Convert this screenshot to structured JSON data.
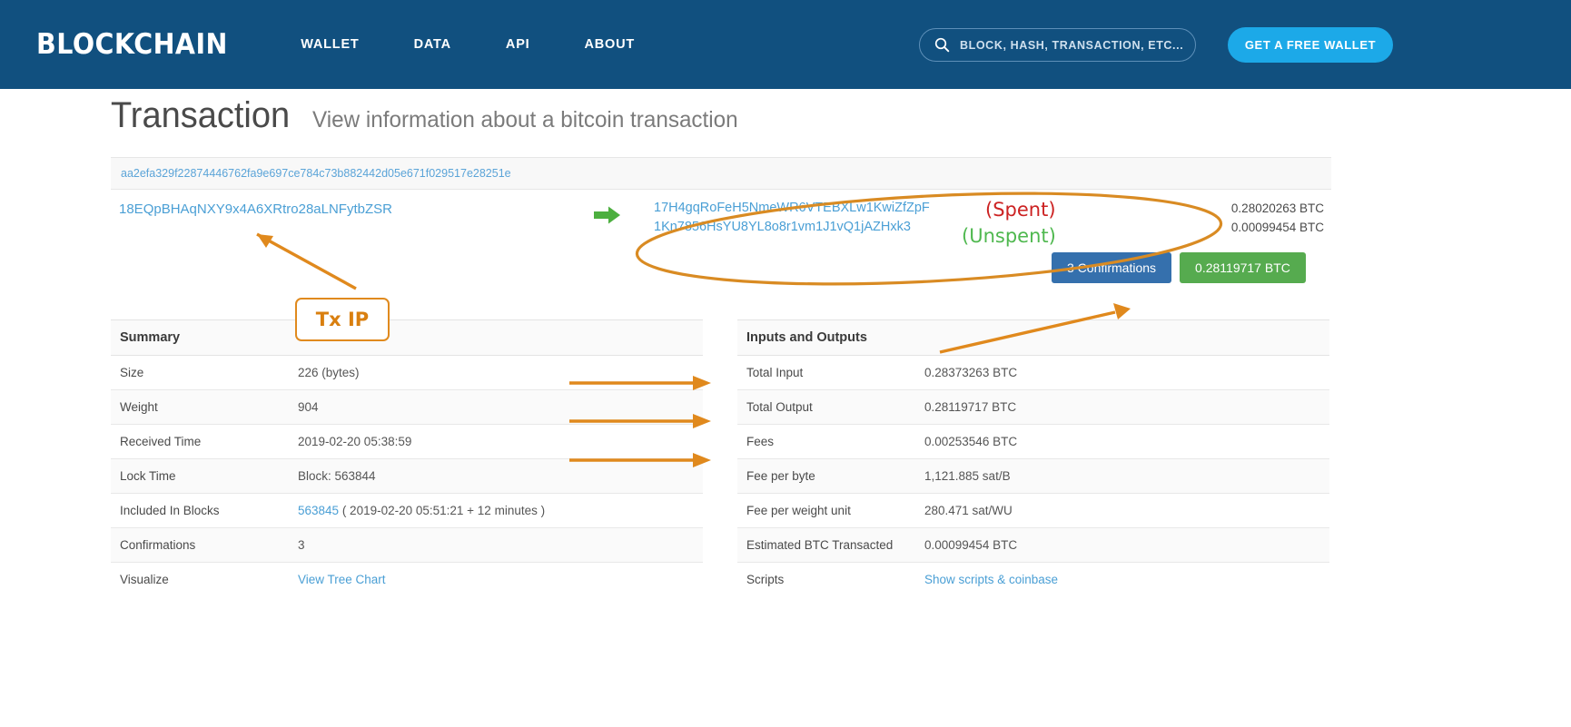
{
  "header": {
    "logo": "BLOCKCHAIN",
    "nav": [
      {
        "label": "WALLET"
      },
      {
        "label": "DATA"
      },
      {
        "label": "API"
      },
      {
        "label": "ABOUT"
      }
    ],
    "search": {
      "placeholder": "BLOCK, HASH, TRANSACTION, ETC...",
      "icon": "search-icon"
    },
    "wallet_button": "GET A FREE WALLET",
    "bg_color": "#11507f",
    "button_color": "#1ca9e8"
  },
  "page": {
    "title": "Transaction",
    "subtitle": "View information about a bitcoin transaction"
  },
  "transaction": {
    "hash": "aa2efa329f22874446762fa9e697ce784c73b882442d05e671f029517e28251e",
    "input_address": "18EQpBHAqNXY9x4A6XRtro28aLNFytbZSR",
    "arrow_icon": "green-right-arrow-icon",
    "outputs": [
      {
        "address": "17H4gqRoFeH5NmeWR6VTEBXLw1KwiZfZpF",
        "amount": "0.28020263 BTC"
      },
      {
        "address": "1Kn7856HsYU8YL8o8r1vm1J1vQ1jAZHxk3",
        "amount": "0.00099454 BTC"
      }
    ],
    "badges": {
      "confirmations": "3 Confirmations",
      "total": "0.28119717 BTC",
      "confirmations_color": "#3570ad",
      "total_color": "#56ab4f"
    }
  },
  "summary": {
    "header": "Summary",
    "rows": [
      {
        "label": "Size",
        "value": "226 (bytes)"
      },
      {
        "label": "Weight",
        "value": "904"
      },
      {
        "label": "Received Time",
        "value": "2019-02-20 05:38:59"
      },
      {
        "label": "Lock Time",
        "value": "Block: 563844"
      },
      {
        "label": "Included In Blocks",
        "value": "563845",
        "suffix": " ( 2019-02-20 05:51:21 + 12 minutes )",
        "link": true
      },
      {
        "label": "Confirmations",
        "value": "3"
      },
      {
        "label": "Visualize",
        "value": "View Tree Chart",
        "link": true
      }
    ]
  },
  "inputs_outputs": {
    "header": "Inputs and Outputs",
    "rows": [
      {
        "label": "Total Input",
        "value": "0.28373263 BTC"
      },
      {
        "label": "Total Output",
        "value": "0.28119717 BTC"
      },
      {
        "label": "Fees",
        "value": "0.00253546 BTC"
      },
      {
        "label": "Fee per byte",
        "value": "1,121.885 sat/B"
      },
      {
        "label": "Fee per weight unit",
        "value": "280.471 sat/WU"
      },
      {
        "label": "Estimated BTC Transacted",
        "value": "0.00099454 BTC"
      },
      {
        "label": "Scripts",
        "value": "Show scripts & coinbase",
        "link": true
      }
    ]
  },
  "annotations": {
    "spent_label": "(Spent)",
    "unspent_label": "(Unspent)",
    "txip_label": "Tx IP",
    "spent_color": "#cc2222",
    "unspent_color": "#4fb84f",
    "marker_color": "#e08a1e"
  }
}
